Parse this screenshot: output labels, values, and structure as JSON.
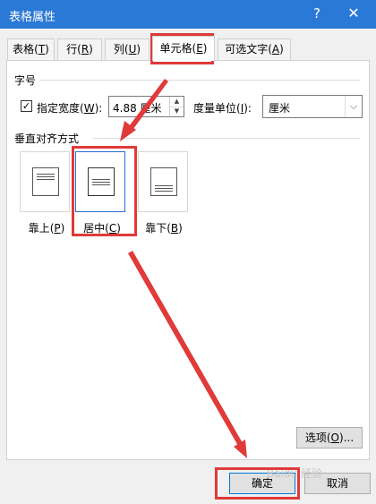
{
  "window": {
    "title": "表格属性",
    "help_glyph": "?",
    "close_glyph": "✕"
  },
  "tabs": [
    {
      "label": "表格",
      "key": "T"
    },
    {
      "label": "行",
      "key": "R"
    },
    {
      "label": "列",
      "key": "U"
    },
    {
      "label": "单元格",
      "key": "E"
    },
    {
      "label": "可选文字",
      "key": "A"
    }
  ],
  "size_group": {
    "label": "字号",
    "checkbox_label": "指定宽度",
    "checkbox_key": "W",
    "checkbox_checked_glyph": "✓",
    "width_value": "4.88 厘米",
    "unit_label": "度量单位",
    "unit_key": "I",
    "unit_value": "厘米"
  },
  "align_group": {
    "label": "垂直对齐方式",
    "options": [
      {
        "label": "靠上",
        "key": "P"
      },
      {
        "label": "居中",
        "key": "C"
      },
      {
        "label": "靠下",
        "key": "B"
      }
    ]
  },
  "options_button": {
    "label": "选项",
    "key": "O",
    "suffix": "..."
  },
  "footer": {
    "ok": "确定",
    "cancel": "取消"
  },
  "watermark": "Baidu 经验",
  "colors": {
    "titlebar": "#2b79d6",
    "annotation": "#e03a3a",
    "selected_border": "#2a6ed4"
  }
}
